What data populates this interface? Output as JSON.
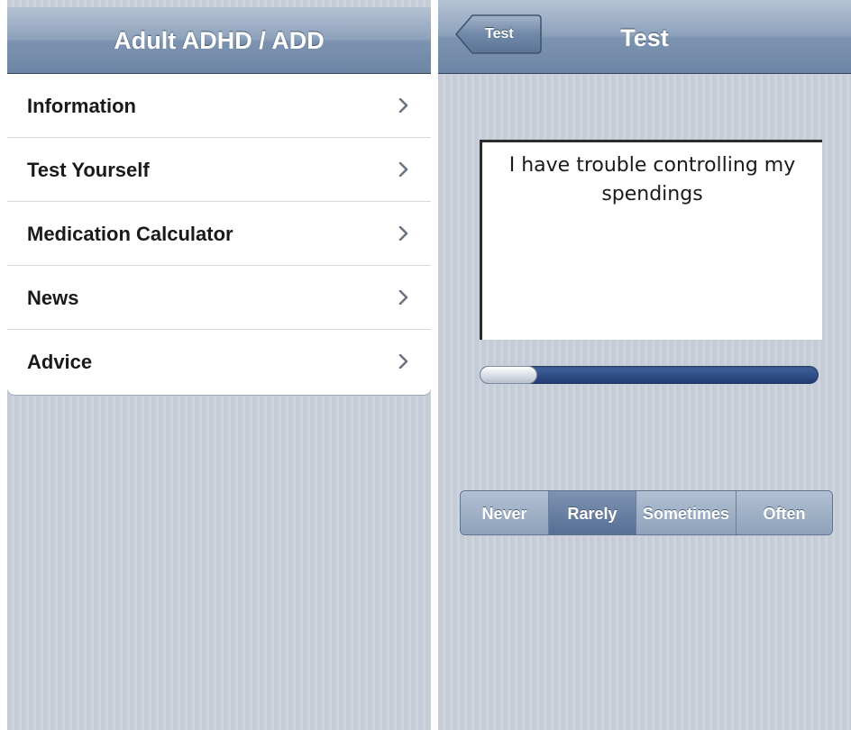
{
  "left_screen": {
    "title": "Adult ADHD / ADD",
    "menu_items": [
      {
        "label": "Information",
        "icon": "chevron-right-icon"
      },
      {
        "label": "Test Yourself",
        "icon": "chevron-right-icon"
      },
      {
        "label": "Medication Calculator",
        "icon": "chevron-right-icon"
      },
      {
        "label": "News",
        "icon": "chevron-right-icon"
      },
      {
        "label": "Advice",
        "icon": "chevron-right-icon"
      }
    ]
  },
  "right_screen": {
    "title": "Test",
    "back_button_label": "Test",
    "question": "I have trouble controlling my spendings",
    "progress_fraction": 0.17,
    "answer_options": [
      "Never",
      "Rarely",
      "Sometimes",
      "Often"
    ],
    "selected_option": "Rarely"
  },
  "colors": {
    "navbar": "#7c93b0",
    "background": "#c5ccd6",
    "progress_track": "#1f3a6f",
    "segment_selected": "#566f94"
  }
}
